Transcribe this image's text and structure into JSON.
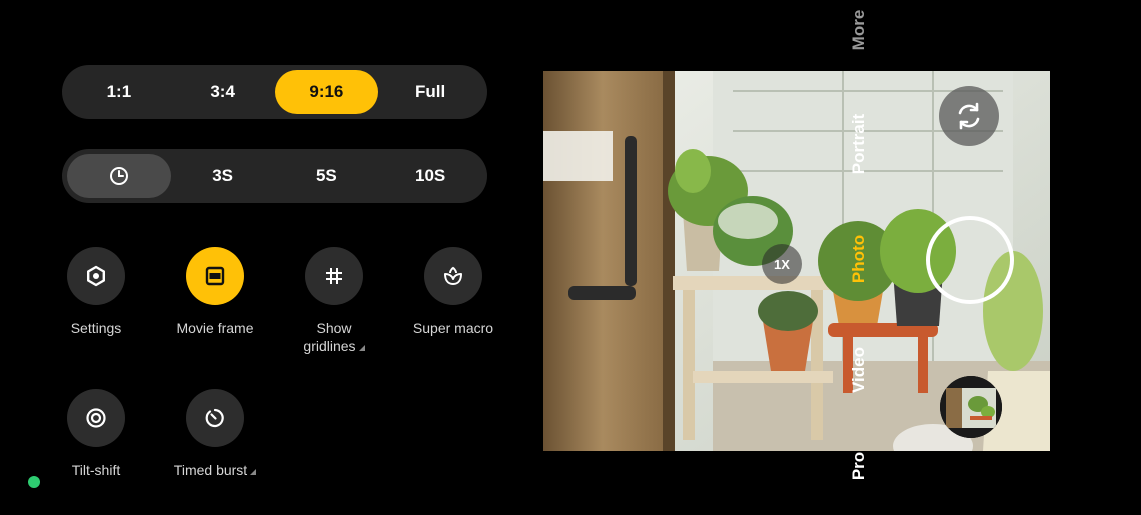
{
  "ratio": {
    "options": [
      "1:1",
      "3:4",
      "9:16",
      "Full"
    ],
    "selected": "9:16"
  },
  "timer": {
    "options": [
      "timer-icon",
      "3S",
      "5S",
      "10S"
    ]
  },
  "tiles": [
    {
      "label": "Settings",
      "icon": "gear-icon"
    },
    {
      "label": "Movie frame",
      "icon": "movie-frame-icon",
      "active": true
    },
    {
      "label": "Show gridlines",
      "icon": "grid-icon",
      "expandable": true
    },
    {
      "label": "Super macro",
      "icon": "flower-icon"
    },
    {
      "label": "Tilt-shift",
      "icon": "tilt-shift-icon"
    },
    {
      "label": "Timed burst",
      "icon": "timer-burst-icon",
      "expandable": true
    }
  ],
  "viewfinder": {
    "zoom": "1X"
  },
  "modes": {
    "more": "More",
    "portrait": "Portrait",
    "photo": "Photo",
    "video": "Video",
    "pro": "Pro"
  },
  "colors": {
    "accent": "#ffc107",
    "status_dot": "#2ecc71",
    "tile_bg": "#2d2d2d"
  }
}
